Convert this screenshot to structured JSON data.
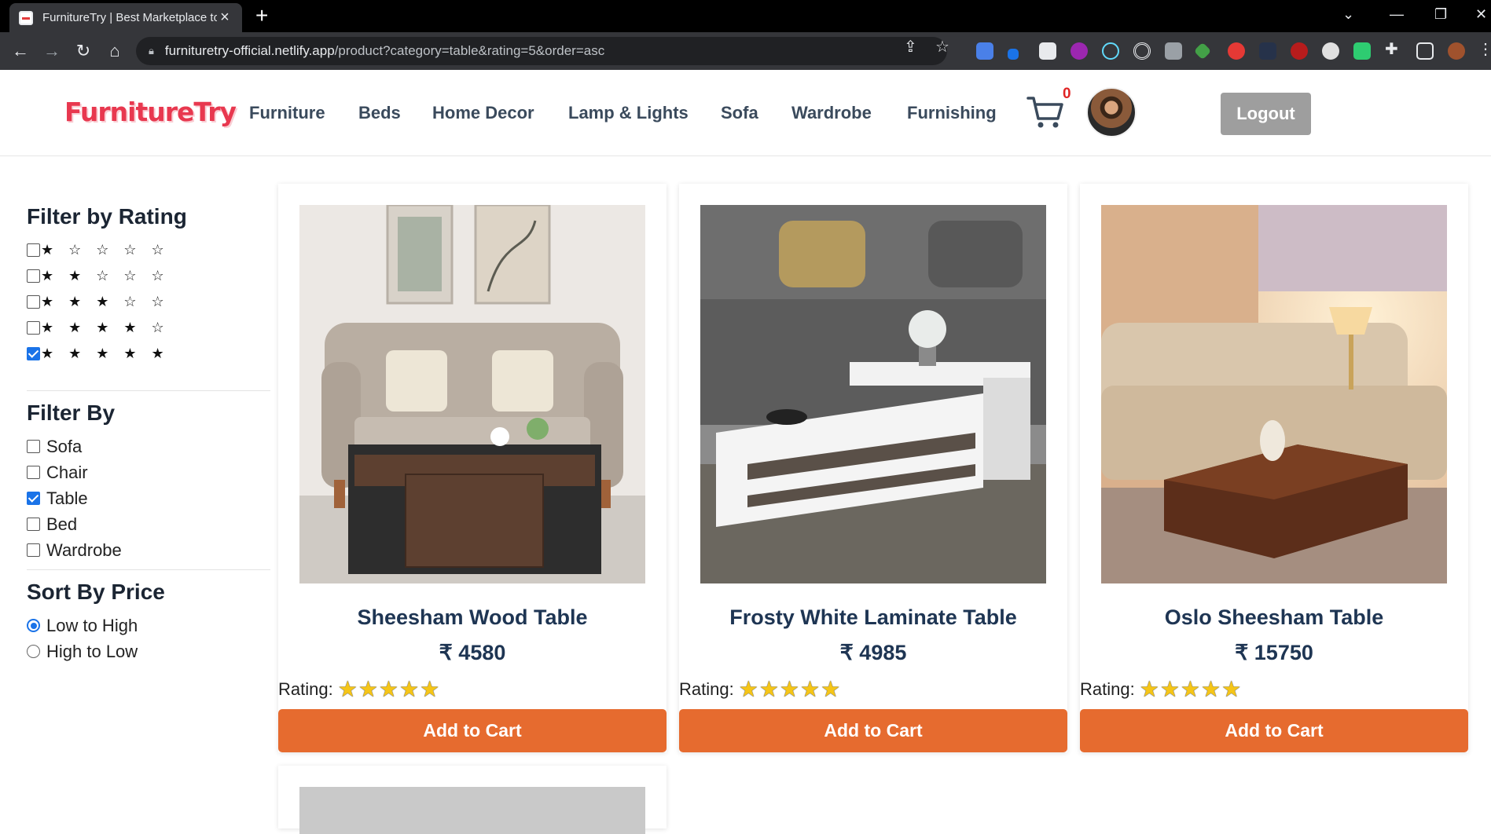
{
  "browser": {
    "tab_title": "FurnitureTry | Best Marketplace to",
    "url_host": "furnituretry-official.netlify.app",
    "url_path": "/product?category=table&rating=5&order=asc"
  },
  "header": {
    "logo": "FurnitureTry",
    "nav": [
      "Furniture",
      "Beds",
      "Home Decor",
      "Lamp & Lights",
      "Sofa",
      "Wardrobe",
      "Furnishing"
    ],
    "cart_count": "0",
    "logout_label": "Logout"
  },
  "sidebar": {
    "rating_heading": "Filter by Rating",
    "ratings": [
      {
        "stars": "★ ☆ ☆ ☆ ☆",
        "checked": false
      },
      {
        "stars": "★ ★ ☆ ☆ ☆",
        "checked": false
      },
      {
        "stars": "★ ★ ★ ☆ ☆",
        "checked": false
      },
      {
        "stars": "★ ★ ★ ★ ☆",
        "checked": false
      },
      {
        "stars": "★ ★ ★ ★ ★",
        "checked": true
      }
    ],
    "category_heading": "Filter By",
    "categories": [
      {
        "label": "Sofa",
        "checked": false
      },
      {
        "label": "Chair",
        "checked": false
      },
      {
        "label": "Table",
        "checked": true
      },
      {
        "label": "Bed",
        "checked": false
      },
      {
        "label": "Wardrobe",
        "checked": false
      }
    ],
    "sort_heading": "Sort By Price",
    "sort_options": [
      {
        "label": "Low to High",
        "selected": true
      },
      {
        "label": "High to Low",
        "selected": false
      }
    ]
  },
  "products": [
    {
      "title": "Sheesham Wood Table",
      "price": "₹ 4580",
      "rating_label": "Rating:",
      "rating_stars": "★★★★★",
      "button": "Add to Cart"
    },
    {
      "title": "Frosty White Laminate Table",
      "price": "₹ 4985",
      "rating_label": "Rating:",
      "rating_stars": "★★★★★",
      "button": "Add to Cart"
    },
    {
      "title": "Oslo Sheesham Table",
      "price": "₹ 15750",
      "rating_label": "Rating:",
      "rating_stars": "★★★★★",
      "button": "Add to Cart"
    }
  ],
  "colors": {
    "logo": "#e8384f",
    "button": "#e66b2f",
    "title": "#1e3553",
    "logout": "#9e9e9e"
  }
}
